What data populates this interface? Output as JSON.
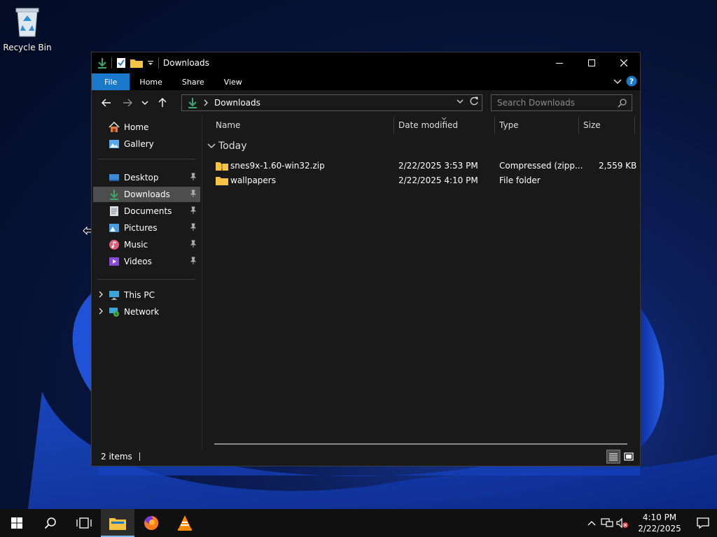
{
  "desktop": {
    "icons": [
      {
        "label": "Recycle Bin",
        "icon": "recycle-bin-icon"
      }
    ]
  },
  "window": {
    "title": "Downloads",
    "ribbon_tabs": [
      "File",
      "Home",
      "Share",
      "View"
    ],
    "address": {
      "crumb": "Downloads"
    },
    "search": {
      "placeholder": "Search Downloads"
    },
    "sidebar": {
      "items": [
        {
          "label": "Home",
          "icon": "home-icon"
        },
        {
          "label": "Gallery",
          "icon": "gallery-icon"
        },
        {
          "label": "Desktop",
          "icon": "desktop-icon",
          "pinned": true
        },
        {
          "label": "Downloads",
          "icon": "downloads-icon",
          "pinned": true,
          "selected": true
        },
        {
          "label": "Documents",
          "icon": "documents-icon",
          "pinned": true
        },
        {
          "label": "Pictures",
          "icon": "pictures-icon",
          "pinned": true
        },
        {
          "label": "Music",
          "icon": "music-icon",
          "pinned": true
        },
        {
          "label": "Videos",
          "icon": "videos-icon",
          "pinned": true
        },
        {
          "label": "This PC",
          "icon": "this-pc-icon",
          "expandable": true
        },
        {
          "label": "Network",
          "icon": "network-icon",
          "expandable": true
        }
      ]
    },
    "columns": [
      "Name",
      "Date modified",
      "Type",
      "Size"
    ],
    "group": "Today",
    "files": [
      {
        "name": "snes9x-1.60-win32.zip",
        "date": "2/22/2025 3:53 PM",
        "type": "Compressed (zipp...",
        "size": "2,559 KB",
        "icon": "zip-folder-icon"
      },
      {
        "name": "wallpapers",
        "date": "2/22/2025 4:10 PM",
        "type": "File folder",
        "size": "",
        "icon": "folder-icon"
      }
    ],
    "status": {
      "count": "2 items"
    }
  },
  "taskbar": {
    "clock": {
      "time": "4:10 PM",
      "date": "2/22/2025"
    }
  },
  "colors": {
    "accent": "#1979ca",
    "window_bg": "#191919",
    "selected": "#4d4d4d",
    "folder": "#f5c444",
    "download_green": "#3fa66b"
  }
}
